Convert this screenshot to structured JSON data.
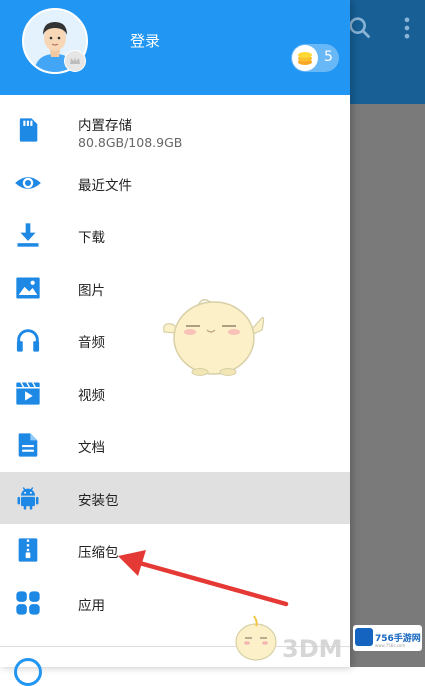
{
  "colors": {
    "header_blue": "#2196f3",
    "icon_blue": "#1e88e5",
    "toolbar_bg": "#175f95",
    "selected_bg": "#e0e0e0",
    "arrow_red": "#e53935"
  },
  "background_app": {
    "icons": [
      "search-icon",
      "more-vert-icon"
    ]
  },
  "drawer": {
    "login_label": "登录",
    "coins": "5",
    "items": [
      {
        "label": "内置存储",
        "sub": "80.8GB/108.9GB",
        "icon": "sd-card-icon"
      },
      {
        "label": "最近文件",
        "icon": "eye-icon"
      },
      {
        "label": "下载",
        "icon": "download-icon"
      },
      {
        "label": "图片",
        "icon": "image-icon"
      },
      {
        "label": "音频",
        "icon": "headphones-icon"
      },
      {
        "label": "视频",
        "icon": "video-icon"
      },
      {
        "label": "文档",
        "icon": "document-icon"
      },
      {
        "label": "安装包",
        "icon": "android-icon",
        "selected": true
      },
      {
        "label": "压缩包",
        "icon": "zip-file-icon"
      },
      {
        "label": "应用",
        "icon": "apps-icon"
      }
    ]
  },
  "watermark": {
    "text": "3DM",
    "logo_text": "756手游网",
    "logo_url": "www.756s.com"
  }
}
